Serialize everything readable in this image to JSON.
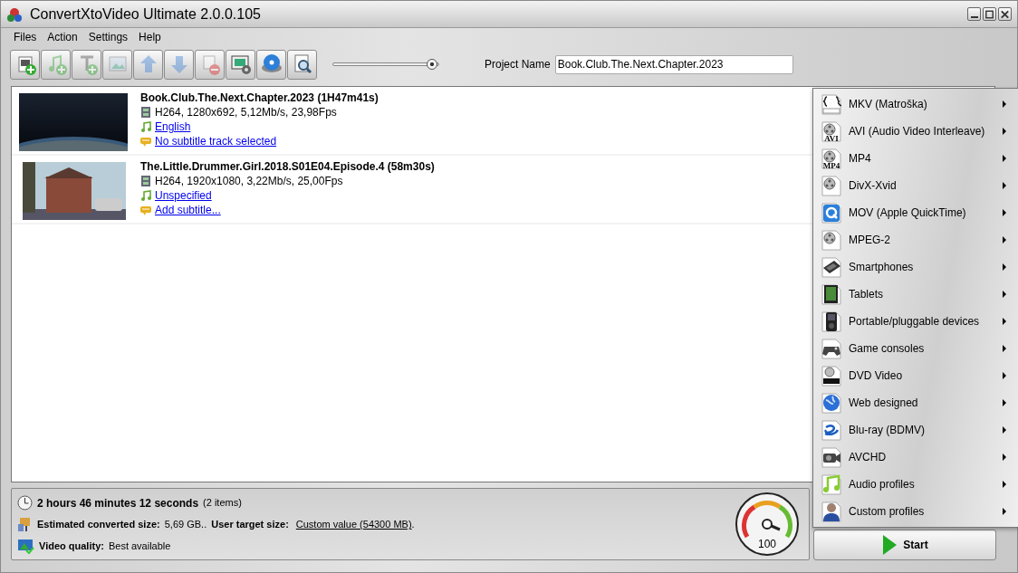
{
  "window": {
    "title": "ConvertXtoVideo Ultimate 2.0.0.105"
  },
  "menu": [
    "Files",
    "Action",
    "Settings",
    "Help"
  ],
  "toolbar": {
    "buttons": [
      {
        "kind": "add-video",
        "disabled": false
      },
      {
        "kind": "add-audio",
        "disabled": true
      },
      {
        "kind": "add-text",
        "disabled": true
      },
      {
        "kind": "edit-picture",
        "disabled": true
      },
      {
        "kind": "up",
        "disabled": true
      },
      {
        "kind": "down",
        "disabled": true
      },
      {
        "kind": "remove",
        "disabled": true
      },
      {
        "kind": "settings",
        "disabled": false
      },
      {
        "kind": "disc",
        "disabled": false
      },
      {
        "kind": "preview",
        "disabled": false
      }
    ],
    "slider": {
      "level": 0.98
    },
    "project_label": "Project Name",
    "project_name": "Book.Club.The.Next.Chapter.2023"
  },
  "videos": [
    {
      "title": "Book.Club.The.Next.Chapter.2023 (1H47m41s)",
      "info": "H264, 1280x692, 5,12Mb/s, 23,98Fps",
      "audio": "English",
      "subtitle": "No subtitle track selected"
    },
    {
      "title": "The.Little.Drummer.Girl.2018.S01E04.Episode.4 (58m30s)",
      "info": "H264, 1920x1080, 3,22Mb/s, 25,00Fps",
      "audio": "Unspecified",
      "subtitle": "Add subtitle..."
    }
  ],
  "formats": [
    {
      "label": "MKV (Matroška)",
      "kind": "mkv"
    },
    {
      "label": "AVI (Audio Video Interleave)",
      "kind": "reel",
      "tag": "AVI"
    },
    {
      "label": "MP4",
      "kind": "reel",
      "tag": "MP4"
    },
    {
      "label": "DivX-Xvid",
      "kind": "reel"
    },
    {
      "label": "MOV (Apple QuickTime)",
      "kind": "quicktime"
    },
    {
      "label": "MPEG-2",
      "kind": "reel"
    },
    {
      "label": "Smartphones",
      "kind": "phone"
    },
    {
      "label": "Tablets",
      "kind": "tablet"
    },
    {
      "label": "Portable/pluggable devices",
      "kind": "player"
    },
    {
      "label": "Game consoles",
      "kind": "gamepad"
    },
    {
      "label": "DVD Video",
      "kind": "dvd"
    },
    {
      "label": "Web designed",
      "kind": "globe"
    },
    {
      "label": "Blu-ray (BDMV)",
      "kind": "bluray"
    },
    {
      "label": "AVCHD",
      "kind": "camera"
    },
    {
      "label": "Audio profiles",
      "kind": "music"
    },
    {
      "label": "Custom profiles",
      "kind": "person"
    }
  ],
  "status": {
    "duration": "2 hours 46 minutes 12 seconds",
    "items": "(2 items)",
    "size_label": "Estimated converted size:",
    "size_value": "5,69 GB..",
    "target_label": "User target size:",
    "target_value": "Custom value (54300 MB)",
    "target_end": ".",
    "quality_label": "Video quality:",
    "quality_value": "Best available",
    "gauge": {
      "reading": "100"
    }
  },
  "start_button": "Start"
}
